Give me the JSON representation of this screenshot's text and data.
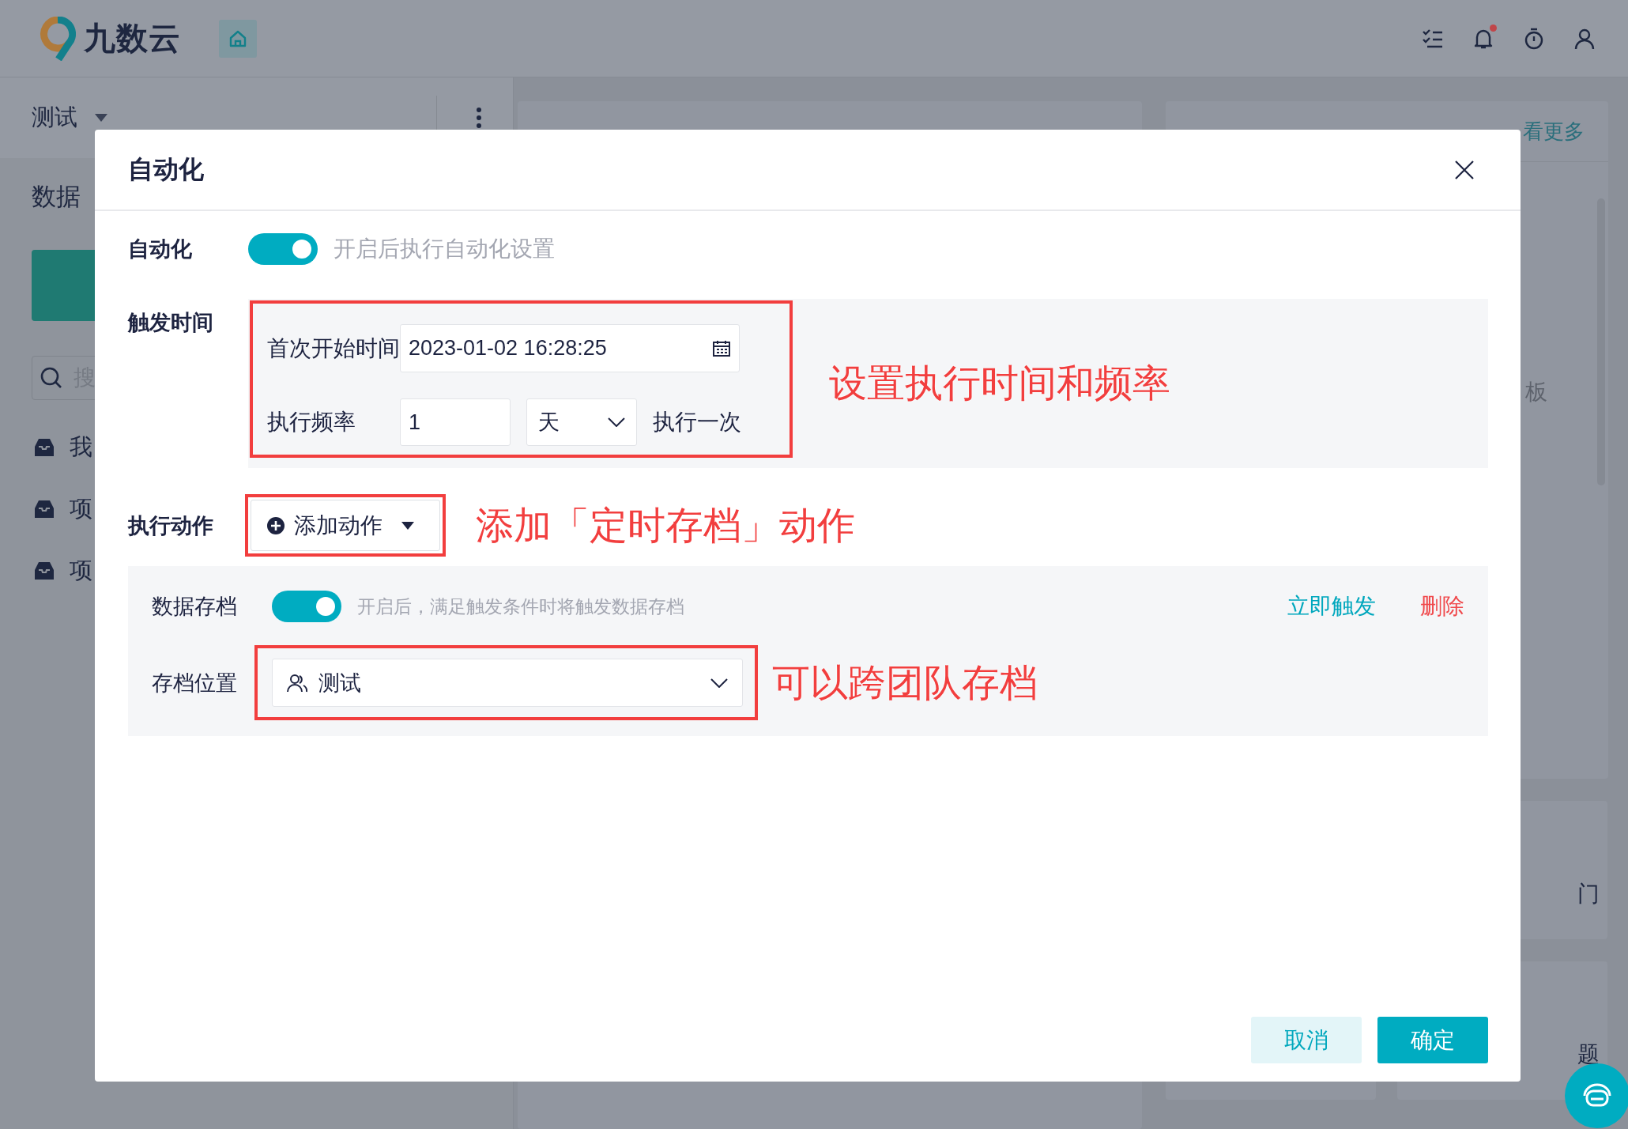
{
  "header": {
    "logo": "九数云",
    "notification_unread": true
  },
  "sidebar": {
    "team": "测试",
    "section_title": "数据",
    "search_placeholder": "搜",
    "items": [
      {
        "label": "我"
      },
      {
        "label": "项"
      },
      {
        "label": "项"
      }
    ]
  },
  "cards": [
    {
      "link": "看更多",
      "text": "板"
    },
    {
      "text": "门"
    },
    {
      "text": "题"
    }
  ],
  "dialog": {
    "title": "自动化",
    "automation": {
      "label": "自动化",
      "on": true,
      "hint": "开启后执行自动化设置"
    },
    "trigger": {
      "label": "触发时间",
      "start_label": "首次开始时间",
      "start_value": "2023-01-02 16:28:25",
      "frequency_label": "执行频率",
      "frequency_value": "1",
      "unit": "天",
      "suffix": "执行一次",
      "annotation": "设置执行时间和频率"
    },
    "action": {
      "label": "执行动作",
      "add_button": "添加动作",
      "annotation": "添加「定时存档」动作"
    },
    "archive": {
      "label": "数据存档",
      "on": true,
      "hint": "开启后，满足触发条件时将触发数据存档",
      "trigger_link": "立即触发",
      "delete_link": "删除",
      "location_label": "存档位置",
      "location_value": "测试",
      "annotation": "可以跨团队存档"
    },
    "buttons": [
      {
        "label": "取消",
        "kind": "secondary"
      },
      {
        "label": "确定",
        "kind": "primary"
      }
    ]
  }
}
